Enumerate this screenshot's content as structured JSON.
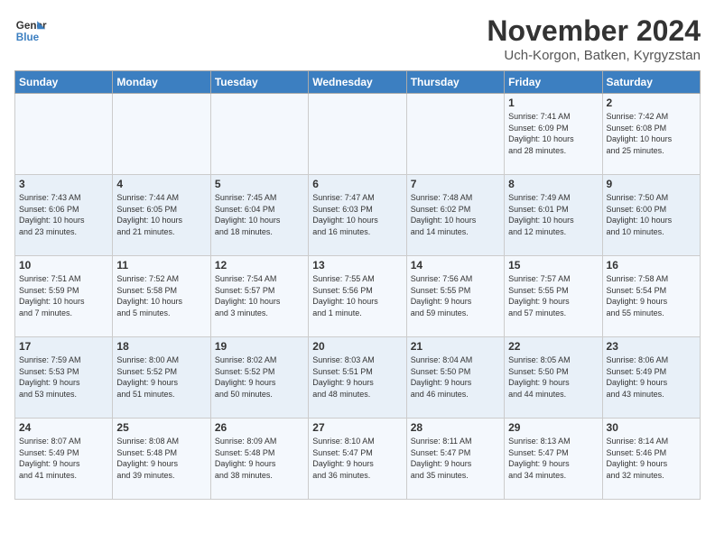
{
  "header": {
    "logo_line1": "General",
    "logo_line2": "Blue",
    "month_title": "November 2024",
    "subtitle": "Uch-Korgon, Batken, Kyrgyzstan"
  },
  "weekdays": [
    "Sunday",
    "Monday",
    "Tuesday",
    "Wednesday",
    "Thursday",
    "Friday",
    "Saturday"
  ],
  "weeks": [
    [
      {
        "day": "",
        "info": ""
      },
      {
        "day": "",
        "info": ""
      },
      {
        "day": "",
        "info": ""
      },
      {
        "day": "",
        "info": ""
      },
      {
        "day": "",
        "info": ""
      },
      {
        "day": "1",
        "info": "Sunrise: 7:41 AM\nSunset: 6:09 PM\nDaylight: 10 hours\nand 28 minutes."
      },
      {
        "day": "2",
        "info": "Sunrise: 7:42 AM\nSunset: 6:08 PM\nDaylight: 10 hours\nand 25 minutes."
      }
    ],
    [
      {
        "day": "3",
        "info": "Sunrise: 7:43 AM\nSunset: 6:06 PM\nDaylight: 10 hours\nand 23 minutes."
      },
      {
        "day": "4",
        "info": "Sunrise: 7:44 AM\nSunset: 6:05 PM\nDaylight: 10 hours\nand 21 minutes."
      },
      {
        "day": "5",
        "info": "Sunrise: 7:45 AM\nSunset: 6:04 PM\nDaylight: 10 hours\nand 18 minutes."
      },
      {
        "day": "6",
        "info": "Sunrise: 7:47 AM\nSunset: 6:03 PM\nDaylight: 10 hours\nand 16 minutes."
      },
      {
        "day": "7",
        "info": "Sunrise: 7:48 AM\nSunset: 6:02 PM\nDaylight: 10 hours\nand 14 minutes."
      },
      {
        "day": "8",
        "info": "Sunrise: 7:49 AM\nSunset: 6:01 PM\nDaylight: 10 hours\nand 12 minutes."
      },
      {
        "day": "9",
        "info": "Sunrise: 7:50 AM\nSunset: 6:00 PM\nDaylight: 10 hours\nand 10 minutes."
      }
    ],
    [
      {
        "day": "10",
        "info": "Sunrise: 7:51 AM\nSunset: 5:59 PM\nDaylight: 10 hours\nand 7 minutes."
      },
      {
        "day": "11",
        "info": "Sunrise: 7:52 AM\nSunset: 5:58 PM\nDaylight: 10 hours\nand 5 minutes."
      },
      {
        "day": "12",
        "info": "Sunrise: 7:54 AM\nSunset: 5:57 PM\nDaylight: 10 hours\nand 3 minutes."
      },
      {
        "day": "13",
        "info": "Sunrise: 7:55 AM\nSunset: 5:56 PM\nDaylight: 10 hours\nand 1 minute."
      },
      {
        "day": "14",
        "info": "Sunrise: 7:56 AM\nSunset: 5:55 PM\nDaylight: 9 hours\nand 59 minutes."
      },
      {
        "day": "15",
        "info": "Sunrise: 7:57 AM\nSunset: 5:55 PM\nDaylight: 9 hours\nand 57 minutes."
      },
      {
        "day": "16",
        "info": "Sunrise: 7:58 AM\nSunset: 5:54 PM\nDaylight: 9 hours\nand 55 minutes."
      }
    ],
    [
      {
        "day": "17",
        "info": "Sunrise: 7:59 AM\nSunset: 5:53 PM\nDaylight: 9 hours\nand 53 minutes."
      },
      {
        "day": "18",
        "info": "Sunrise: 8:00 AM\nSunset: 5:52 PM\nDaylight: 9 hours\nand 51 minutes."
      },
      {
        "day": "19",
        "info": "Sunrise: 8:02 AM\nSunset: 5:52 PM\nDaylight: 9 hours\nand 50 minutes."
      },
      {
        "day": "20",
        "info": "Sunrise: 8:03 AM\nSunset: 5:51 PM\nDaylight: 9 hours\nand 48 minutes."
      },
      {
        "day": "21",
        "info": "Sunrise: 8:04 AM\nSunset: 5:50 PM\nDaylight: 9 hours\nand 46 minutes."
      },
      {
        "day": "22",
        "info": "Sunrise: 8:05 AM\nSunset: 5:50 PM\nDaylight: 9 hours\nand 44 minutes."
      },
      {
        "day": "23",
        "info": "Sunrise: 8:06 AM\nSunset: 5:49 PM\nDaylight: 9 hours\nand 43 minutes."
      }
    ],
    [
      {
        "day": "24",
        "info": "Sunrise: 8:07 AM\nSunset: 5:49 PM\nDaylight: 9 hours\nand 41 minutes."
      },
      {
        "day": "25",
        "info": "Sunrise: 8:08 AM\nSunset: 5:48 PM\nDaylight: 9 hours\nand 39 minutes."
      },
      {
        "day": "26",
        "info": "Sunrise: 8:09 AM\nSunset: 5:48 PM\nDaylight: 9 hours\nand 38 minutes."
      },
      {
        "day": "27",
        "info": "Sunrise: 8:10 AM\nSunset: 5:47 PM\nDaylight: 9 hours\nand 36 minutes."
      },
      {
        "day": "28",
        "info": "Sunrise: 8:11 AM\nSunset: 5:47 PM\nDaylight: 9 hours\nand 35 minutes."
      },
      {
        "day": "29",
        "info": "Sunrise: 8:13 AM\nSunset: 5:47 PM\nDaylight: 9 hours\nand 34 minutes."
      },
      {
        "day": "30",
        "info": "Sunrise: 8:14 AM\nSunset: 5:46 PM\nDaylight: 9 hours\nand 32 minutes."
      }
    ]
  ]
}
